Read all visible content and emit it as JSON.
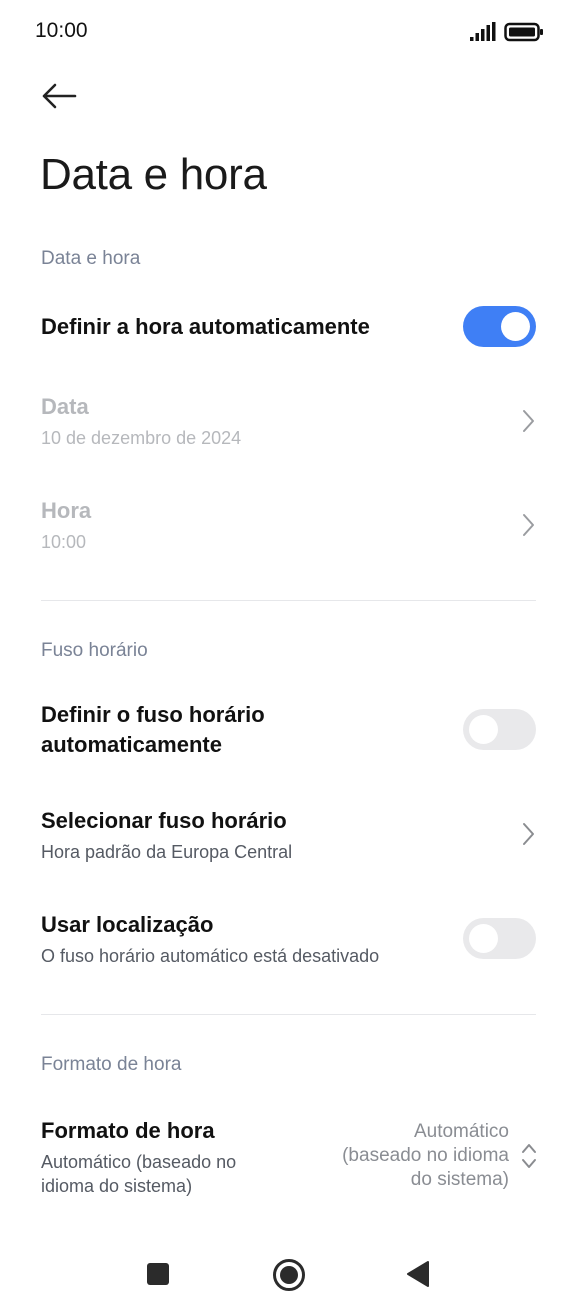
{
  "status_bar": {
    "time": "10:00",
    "icons": [
      "signal-icon",
      "battery-icon"
    ]
  },
  "header": {
    "back_icon": "arrow-left-icon",
    "title": "Data e hora"
  },
  "sections": {
    "date_time": {
      "header": "Data e hora",
      "auto_time": {
        "title": "Definir a hora automaticamente",
        "toggle_on": true
      },
      "date": {
        "title": "Data",
        "value": "10 de dezembro de 2024"
      },
      "time": {
        "title": "Hora",
        "value": "10:00"
      }
    },
    "time_zone": {
      "header": "Fuso horário",
      "auto_zone": {
        "title_line1": "Definir o fuso horário",
        "title_line2": "automaticamente",
        "toggle_on": false
      },
      "select_zone": {
        "title": "Selecionar fuso horário",
        "value": "Hora padrão da Europa Central"
      },
      "use_location": {
        "title": "Usar localização",
        "value": "O fuso horário automático está desativado",
        "toggle_on": false
      }
    },
    "time_format": {
      "header": "Formato de hora",
      "format": {
        "title": "Formato de hora",
        "sub_line1": "Automático (baseado no",
        "sub_line2": "idioma do sistema)",
        "value_line1": "Automático",
        "value_line2": "(baseado no idioma",
        "value_line3": "do sistema)"
      }
    }
  },
  "nav_bar": {
    "icons": [
      "recents-square-icon",
      "home-circle-icon",
      "back-triangle-icon"
    ]
  },
  "colors": {
    "accent": "#3f7ff5",
    "section_header": "#7a8396",
    "disabled_text": "#b6b8bc"
  }
}
